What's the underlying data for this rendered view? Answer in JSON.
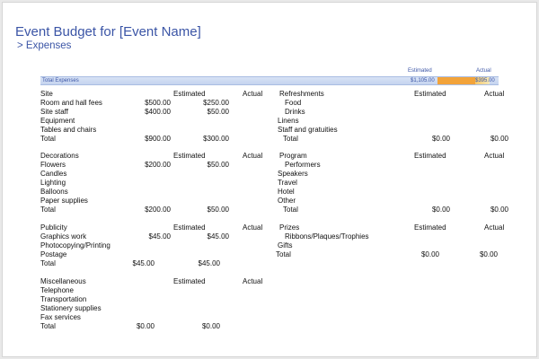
{
  "header": {
    "title": "Event Budget for [Event Name]",
    "subtitle": "> Expenses"
  },
  "summary": {
    "estimated_header": "Estimated",
    "actual_header": "Actual",
    "label": "Total Expenses",
    "estimated": "$1,105.00",
    "actual": "$395.00",
    "colors": {
      "band": "#c5d4ef",
      "estimated_fill": "#f2a33a",
      "actual_fill": "#f6c86a"
    }
  },
  "left_sections": [
    {
      "name": "Site",
      "estimated_header": "Estimated",
      "actual_header": "Actual",
      "items": [
        {
          "label": "Room and hall fees",
          "estimated": "$500.00",
          "actual": "$250.00"
        },
        {
          "label": "Site staff",
          "estimated": "$400.00",
          "actual": "$50.00"
        },
        {
          "label": "Equipment",
          "estimated": "",
          "actual": ""
        },
        {
          "label": "Tables and chairs",
          "estimated": "",
          "actual": ""
        }
      ],
      "total_label": "Total",
      "total_estimated": "$900.00",
      "total_actual": "$300.00"
    },
    {
      "name": "Decorations",
      "estimated_header": "Estimated",
      "actual_header": "Actual",
      "items": [
        {
          "label": "Flowers",
          "estimated": "$200.00",
          "actual": "$50.00"
        },
        {
          "label": "Candles",
          "estimated": "",
          "actual": ""
        },
        {
          "label": "Lighting",
          "estimated": "",
          "actual": ""
        },
        {
          "label": "Balloons",
          "estimated": "",
          "actual": ""
        },
        {
          "label": "Paper supplies",
          "estimated": "",
          "actual": ""
        }
      ],
      "total_label": "Total",
      "total_estimated": "$200.00",
      "total_actual": "$50.00"
    },
    {
      "name": "Publicity",
      "estimated_header": "Estimated",
      "actual_header": "Actual",
      "items": [
        {
          "label": "Graphics work",
          "estimated": "$45.00",
          "actual": "$45.00"
        },
        {
          "label": "Photocopying/Printing",
          "estimated": "",
          "actual": ""
        },
        {
          "label": "Postage",
          "estimated": "",
          "actual": ""
        }
      ],
      "total_label": "Total",
      "total_estimated": "$45.00",
      "total_actual": "$45.00"
    },
    {
      "name": "Miscellaneous",
      "estimated_header": "Estimated",
      "actual_header": "Actual",
      "items": [
        {
          "label": "Telephone",
          "estimated": "",
          "actual": ""
        },
        {
          "label": "Transportation",
          "estimated": "",
          "actual": ""
        },
        {
          "label": "Stationery supplies",
          "estimated": "",
          "actual": ""
        },
        {
          "label": "Fax services",
          "estimated": "",
          "actual": ""
        }
      ],
      "total_label": "Total",
      "total_estimated": "$0.00",
      "total_actual": "$0.00"
    }
  ],
  "right_sections": [
    {
      "name": "Refreshments",
      "estimated_header": "Estimated",
      "actual_header": "Actual",
      "items": [
        {
          "label": "Food",
          "estimated": "",
          "actual": ""
        },
        {
          "label": "Drinks",
          "estimated": "",
          "actual": ""
        },
        {
          "label": "Linens",
          "estimated": "",
          "actual": ""
        },
        {
          "label": "Staff and gratuities",
          "estimated": "",
          "actual": ""
        }
      ],
      "total_label": "Total",
      "total_estimated": "$0.00",
      "total_actual": "$0.00"
    },
    {
      "name": "Program",
      "estimated_header": "Estimated",
      "actual_header": "Actual",
      "items": [
        {
          "label": "Performers",
          "estimated": "",
          "actual": ""
        },
        {
          "label": "Speakers",
          "estimated": "",
          "actual": ""
        },
        {
          "label": "Travel",
          "estimated": "",
          "actual": ""
        },
        {
          "label": "Hotel",
          "estimated": "",
          "actual": ""
        },
        {
          "label": "Other",
          "estimated": "",
          "actual": ""
        }
      ],
      "total_label": "Total",
      "total_estimated": "$0.00",
      "total_actual": "$0.00"
    },
    {
      "name": "Prizes",
      "estimated_header": "Estimated",
      "actual_header": "Actual",
      "items": [
        {
          "label": "Ribbons/Plaques/Trophies",
          "estimated": "",
          "actual": ""
        },
        {
          "label": "Gifts",
          "estimated": "",
          "actual": ""
        }
      ],
      "total_label": "Total",
      "total_estimated": "$0.00",
      "total_actual": "$0.00"
    }
  ]
}
